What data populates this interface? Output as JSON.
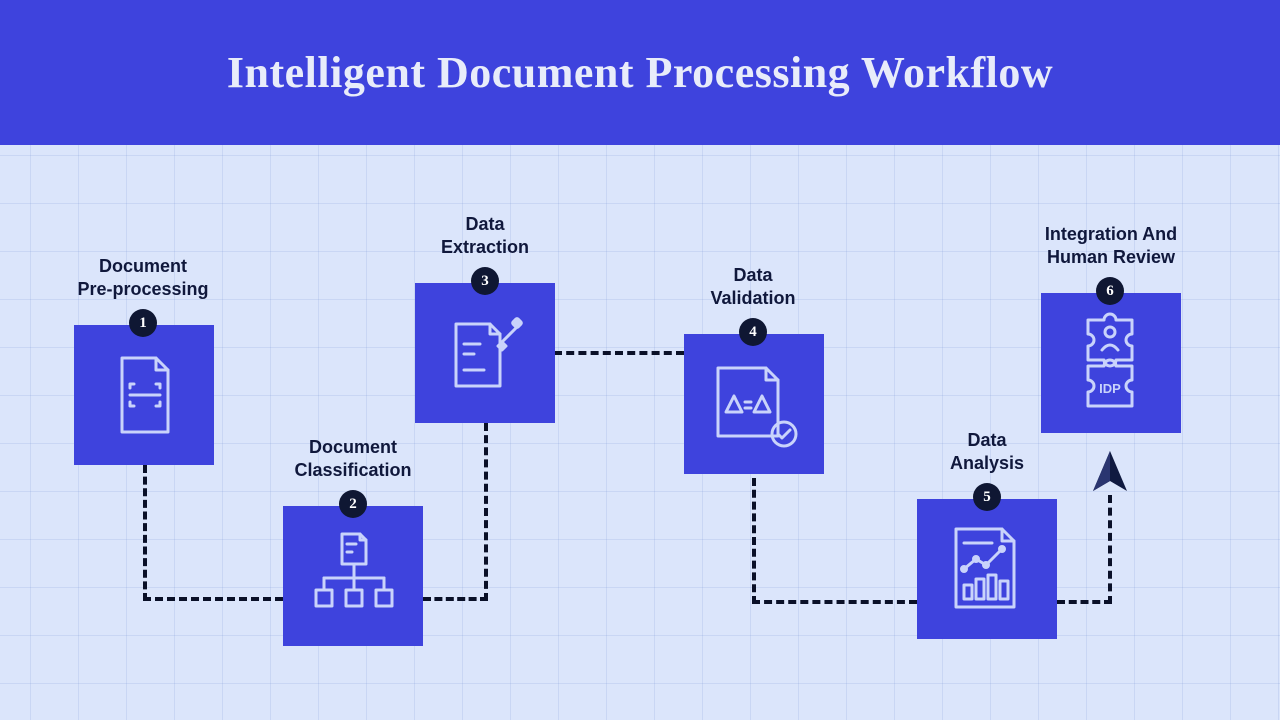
{
  "header": {
    "title": "Intelligent Document Processing Workflow"
  },
  "steps": [
    {
      "num": "1",
      "line1": "Document",
      "line2": "Pre-processing",
      "icon": "document-scan-icon"
    },
    {
      "num": "2",
      "line1": "Document",
      "line2": "Classification",
      "icon": "document-hierarchy-icon"
    },
    {
      "num": "3",
      "line1": "Data",
      "line2": "Extraction",
      "icon": "document-edit-icon"
    },
    {
      "num": "4",
      "line1": "Data",
      "line2": "Validation",
      "icon": "document-check-icon"
    },
    {
      "num": "5",
      "line1": "Data",
      "line2": "Analysis",
      "icon": "document-chart-icon"
    },
    {
      "num": "6",
      "line1": "Integration And",
      "line2": "Human Review",
      "icon": "puzzle-person-icon",
      "icon_text": "IDP"
    }
  ],
  "colors": {
    "header_bg": "#3e43dd",
    "box_bg": "#3e43dd",
    "page_bg": "#dbe5fb",
    "text_dark": "#10183c"
  }
}
